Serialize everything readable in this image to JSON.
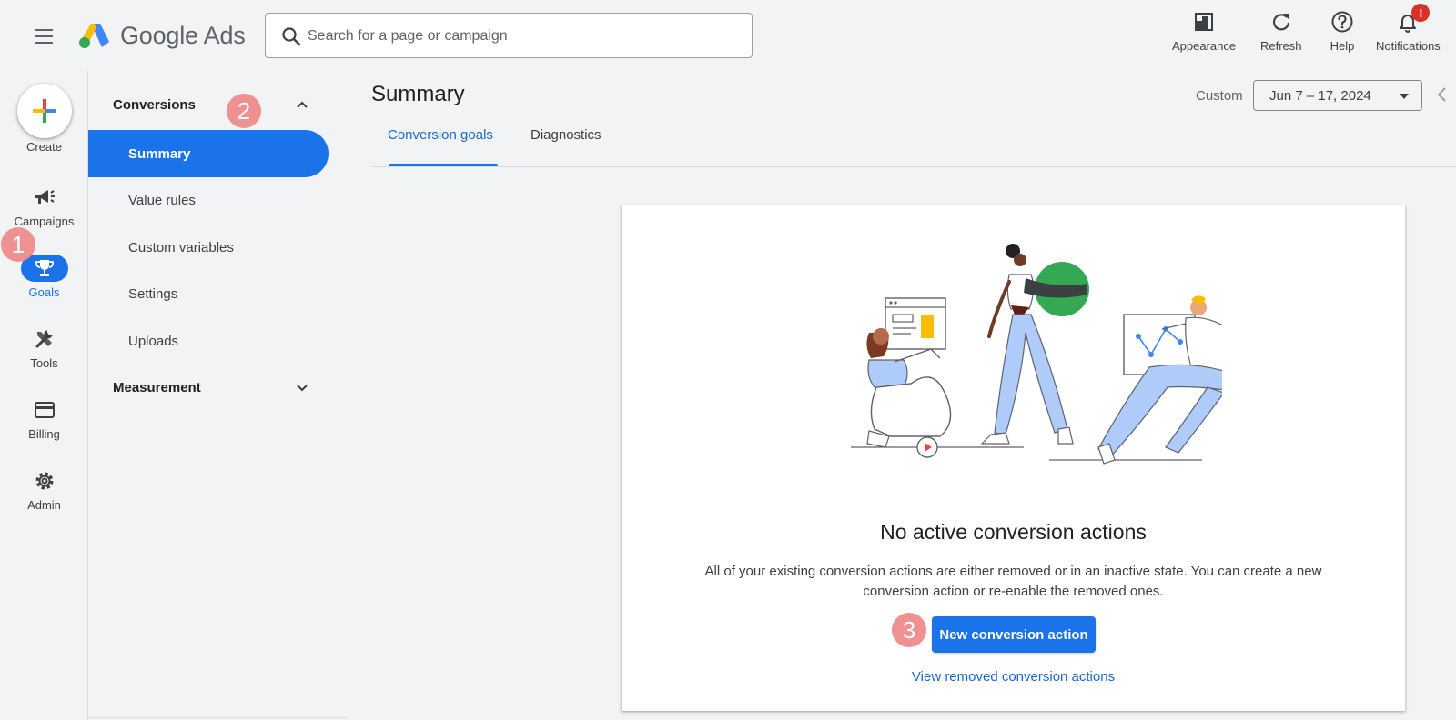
{
  "app": {
    "name": "Google Ads"
  },
  "search": {
    "placeholder": "Search for a page or campaign"
  },
  "top_actions": {
    "appearance": "Appearance",
    "refresh": "Refresh",
    "help": "Help",
    "notifications": "Notifications",
    "notifications_badge": "!"
  },
  "rail": {
    "create": "Create",
    "campaigns": "Campaigns",
    "goals": "Goals",
    "tools": "Tools",
    "billing": "Billing",
    "admin": "Admin"
  },
  "subnav": {
    "conversions": "Conversions",
    "items": [
      "Summary",
      "Value rules",
      "Custom variables",
      "Settings",
      "Uploads"
    ],
    "measurement": "Measurement"
  },
  "main": {
    "title": "Summary",
    "date_label": "Custom",
    "date_range": "Jun 7 – 17, 2024",
    "tabs": [
      "Conversion goals",
      "Diagnostics"
    ]
  },
  "empty_state": {
    "title": "No active conversion actions",
    "description": "All of your existing conversion actions are either removed or in an inactive state. You can create a new conversion action or re-enable the removed ones.",
    "primary_button": "New conversion action",
    "link": "View removed conversion actions"
  },
  "markers": [
    "1",
    "2",
    "3"
  ],
  "colors": {
    "accent": "#1a73e8",
    "link": "#1967d2",
    "marker": "#f08c8c",
    "badge": "#d93025",
    "background": "#f1f3f4"
  }
}
